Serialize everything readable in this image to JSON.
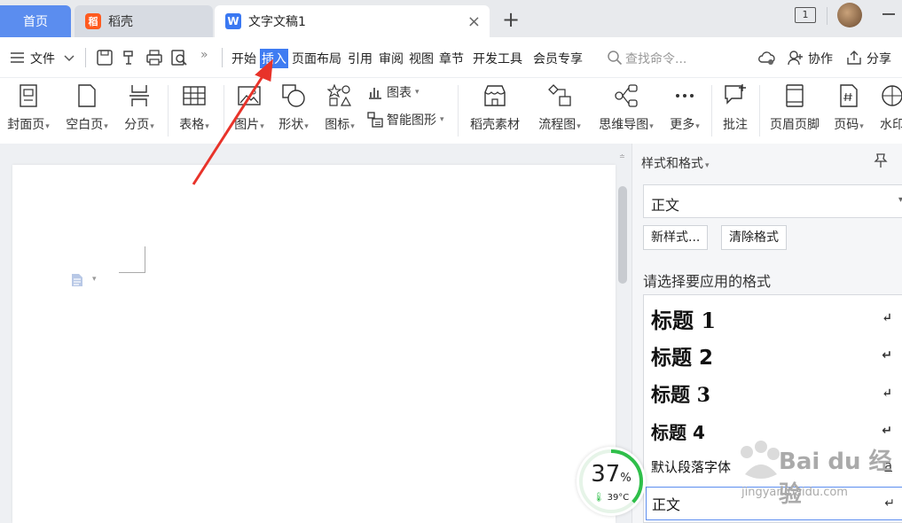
{
  "tabbar": {
    "home_label": "首页",
    "docer_label": "稻壳",
    "doc_label": "文字文稿1",
    "docer_logo": "稻",
    "doc_logo": "W",
    "close_glyph": "×",
    "newtab_glyph": "+",
    "window_badge": "1"
  },
  "menubar": {
    "file": "文件",
    "items": [
      "开始",
      "插入",
      "页面布局",
      "引用",
      "审阅",
      "视图",
      "章节",
      "开发工具",
      "会员专享"
    ],
    "search_placeholder": "查找命令...",
    "collab": "协作",
    "share": "分享",
    "more": "»"
  },
  "ribbon": {
    "cover": "封面页",
    "blank": "空白页",
    "pagebreak": "分页",
    "table": "表格",
    "picture": "图片",
    "shape": "形状",
    "icon": "图标",
    "chart": "图表",
    "smartart": "智能图形",
    "docer_material": "稻壳素材",
    "flowchart": "流程图",
    "mindmap": "思维导图",
    "more": "更多",
    "comment": "批注",
    "header_footer": "页眉页脚",
    "page_number": "页码",
    "watermark": "水印"
  },
  "pane": {
    "title": "样式和格式",
    "current_style": "正文",
    "new_style": "新样式...",
    "clear_format": "清除格式",
    "hint": "请选择要应用的格式",
    "styles": [
      {
        "name": "标题 1",
        "mark": "↵"
      },
      {
        "name": "标题 2",
        "mark": "↵"
      },
      {
        "name": "标题 3",
        "mark": "↵"
      },
      {
        "name": "标题 4",
        "mark": "↵"
      },
      {
        "name": "默认段落字体",
        "mark": "a"
      },
      {
        "name": "正文",
        "mark": "↵"
      }
    ]
  },
  "perf": {
    "percent": "37",
    "percent_sign": "%",
    "temp": "39°C",
    "usage": 0.37
  },
  "watermark": {
    "text": "Bai du 经验",
    "sub": "jingyan.baidu.com"
  },
  "colors": {
    "accent": "#3f7cf2",
    "home_tab": "#5b8def",
    "arrow": "#e8332a",
    "perf_ring": "#2fbf4a"
  }
}
